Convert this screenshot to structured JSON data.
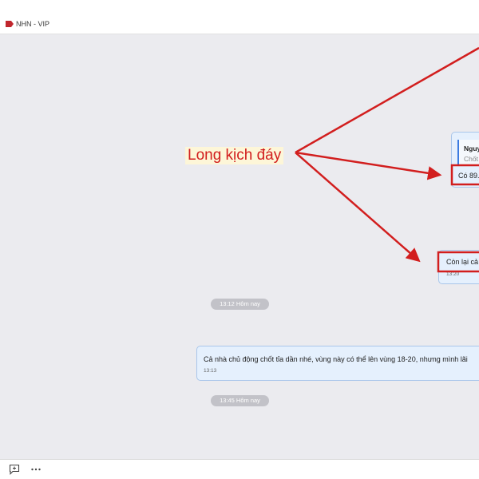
{
  "header": {
    "title": "NHN - VIP"
  },
  "messages": {
    "quote_author": "Nguy",
    "quote_text": "Chốt",
    "msg1_text": "Có 89.",
    "msg2_text": "Còn lại cả",
    "msg2_time": "13:20",
    "msg3_text": "Cả nhà chủ động chốt tỉa dần nhé, vùng này có thể lên vùng 18-20, nhưng mình lãi",
    "msg3_time": "13:13"
  },
  "timestamps": {
    "ts1": "13:12 Hôm nay",
    "ts2": "13:45 Hôm nay"
  },
  "annotation": {
    "text": "Long kịch đáy",
    "color": "#d21e1e"
  },
  "colors": {
    "accent_red": "#d21e1e",
    "bubble_bg": "#e5f0fd",
    "bubble_border": "#a9c6ea",
    "chat_bg": "#ebebef"
  },
  "icons": {
    "tag": "tag-icon",
    "reply": "add-message-icon",
    "more": "more-dots-icon"
  }
}
